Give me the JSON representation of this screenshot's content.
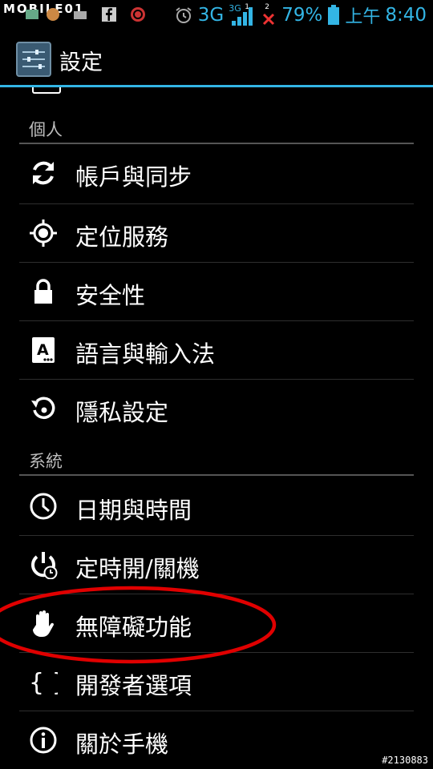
{
  "status_bar": {
    "watermark": "MOBILE01",
    "network": "3G",
    "network_small": "3G",
    "signal_index": "1",
    "notif_count": "2",
    "battery": "79%",
    "ampm": "上午",
    "time": "8:40",
    "icons": [
      "notification-icons",
      "alarm-icon",
      "signal-icon",
      "sim-x-icon",
      "battery-icon"
    ]
  },
  "action_bar": {
    "title": "設定",
    "icon": "settings-app-icon"
  },
  "sections": [
    {
      "header": "個人",
      "items": [
        {
          "label": "帳戶與同步",
          "icon": "sync-icon"
        },
        {
          "label": "定位服務",
          "icon": "location-icon"
        },
        {
          "label": "安全性",
          "icon": "lock-icon"
        },
        {
          "label": "語言與輸入法",
          "icon": "language-icon"
        },
        {
          "label": "隱私設定",
          "icon": "privacy-icon"
        }
      ]
    },
    {
      "header": "系統",
      "items": [
        {
          "label": "日期與時間",
          "icon": "clock-icon"
        },
        {
          "label": "定時開/關機",
          "icon": "scheduled-power-icon"
        },
        {
          "label": "無障礙功能",
          "icon": "hand-icon"
        },
        {
          "label": "開發者選項",
          "icon": "braces-icon"
        },
        {
          "label": "關於手機",
          "icon": "info-icon"
        }
      ]
    }
  ],
  "annotation_color": "#e00000",
  "accent_color": "#33b5e5",
  "image_id": "#2130883"
}
